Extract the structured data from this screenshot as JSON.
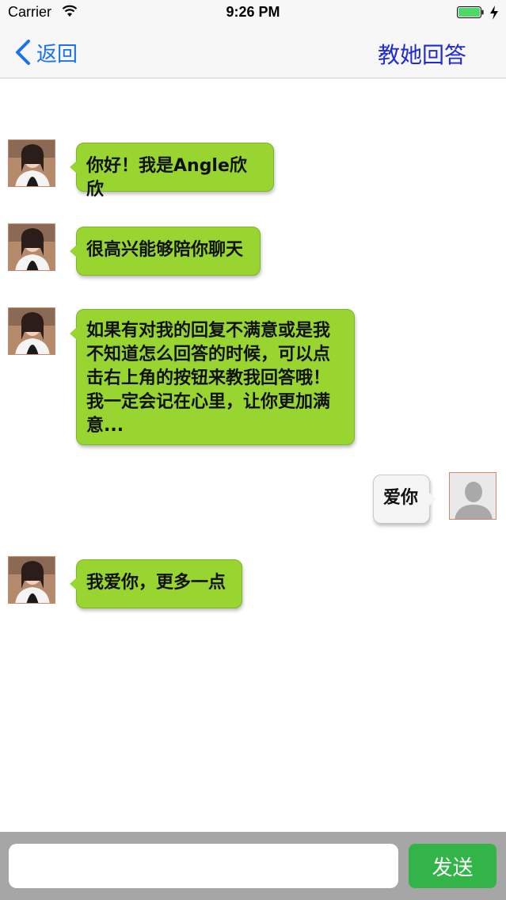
{
  "status_bar": {
    "carrier": "Carrier",
    "time": "9:26 PM"
  },
  "nav": {
    "back_label": "返回",
    "right_button_label": "教她回答",
    "accent_color": "#1a73e8"
  },
  "messages": [
    {
      "sender": "bot",
      "text": "你好！我是Angle欣欣"
    },
    {
      "sender": "bot",
      "text": "很高兴能够陪你聊天"
    },
    {
      "sender": "bot",
      "text": "如果有对我的回复不满意或是我\n不知道怎么回答的时候，可以点\n击右上角的按钮来教我回答哦！\n我一定会记在心里，让你更加满\n意..."
    },
    {
      "sender": "user",
      "text": "爱你"
    },
    {
      "sender": "bot",
      "text": "我爱你，更多一点"
    }
  ],
  "input_bar": {
    "placeholder": "",
    "value": "",
    "send_label": "发送",
    "send_color": "#33b449"
  },
  "colors": {
    "bot_bubble": "#98d531",
    "user_bubble": "#f5f5f5"
  }
}
